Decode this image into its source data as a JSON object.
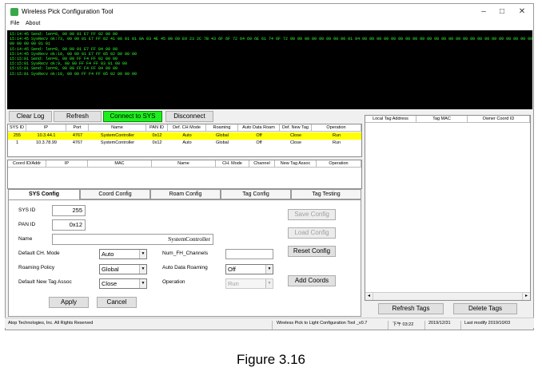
{
  "window": {
    "title": "Wireless Pick Configuration Tool",
    "minimize": "–",
    "maximize": "□",
    "close": "✕"
  },
  "menu": {
    "file": "File",
    "about": "About"
  },
  "console": {
    "lines": [
      "15:14:45 Send: len=8, 00 00 01 E7 FF 02 00 00",
      "15:14:45 SysRecv ok:73, 00 00 01 E7 FF 02 41 00 01 01 0A 03 4E 45 00 60 E9 23 2C 7B 43 6F 6F 72 64 69 6E 61 74 6F 72 00 00 00 00 00 00 00 00 01 04 00 00 00 00 00 00 00 00 00 00 00 00 00 00 00 00 00 00 00 00 00 00 00 00 00 00 00 00 00 00 00",
      "00 00 00 00 01 01",
      "15:14:45 Send: len=8, 00 00 01 E7 FF 04 00 00",
      "15:14:45 SysRecv ok:10, 00 00 01 E7 FF 05 02 00 00 00",
      "15:15:01 Send: len=8, 00 00 FF F4 FF 02 00 00",
      "15:15:01 SysRecv ok:9, 00 00 FF F4 FF 03 01 00 00",
      "15:15:01 Send: len=8, 00 00 FF F4 FF 04 00 00",
      "15:15:01 SysRecv ok:10, 00 00 FF F4 FF 05 02 00 00 00"
    ]
  },
  "toolbar": {
    "clear_log": "Clear Log",
    "refresh": "Refresh",
    "connect": "Connect to SYS",
    "disconnect": "Disconnect"
  },
  "sys_table": {
    "headers": [
      "SYS ID",
      "IP",
      "Port",
      "Name",
      "PAN ID",
      "Def. CH Mode",
      "Roaming",
      "Auto Data Roam",
      "Def. New Tag",
      "Operation"
    ],
    "rows": [
      [
        "255",
        "10.3.44.1",
        "4767",
        "SystemController",
        "0x12",
        "Auto",
        "Global",
        "Off",
        "Close",
        "Run"
      ],
      [
        "1",
        "10.3.78.99",
        "4767",
        "SystemController",
        "0x12",
        "Auto",
        "Global",
        "Off",
        "Close",
        "Run"
      ]
    ],
    "selected_color": "#ffff00"
  },
  "coord_table": {
    "headers": [
      "Coord ID/Addr",
      "IP",
      "MAC",
      "Name",
      "CH. Mode",
      "Channel",
      "New Tag Assoc",
      "Operation"
    ]
  },
  "tag_table": {
    "headers": [
      "Local Tag Address",
      "Tag MAC",
      "Owner Coord ID"
    ]
  },
  "tabs": [
    "SYS Config",
    "Coord Config",
    "Roam Config",
    "Tag Config",
    "Tag Testing"
  ],
  "form": {
    "sys_id_label": "SYS ID",
    "sys_id": "255",
    "pan_id_label": "PAN ID",
    "pan_id": "0x12",
    "name_label": "Name",
    "name": "SystemController",
    "def_ch_label": "Default CH. Mode",
    "def_ch": "Auto",
    "roaming_label": "Roaming Policy",
    "roaming": "Global",
    "new_tag_label": "Default New Tag Assoc",
    "new_tag": "Close",
    "num_fh_label": "Num_FH_Channels",
    "num_fh": "",
    "auto_roam_label": "Auto Data Roaming",
    "auto_roam": "Off",
    "operation_label": "Operation",
    "operation": "Run",
    "save_config": "Save Config",
    "load_config": "Load Config",
    "reset_config": "Reset Config",
    "add_coords": "Add Coords",
    "apply": "Apply",
    "cancel": "Cancel"
  },
  "tag_buttons": {
    "refresh_tags": "Refresh Tags",
    "delete_tags": "Delete Tags"
  },
  "status": {
    "company": "Atop Technologies, Inc. All Rights Reserved",
    "version": "Wireless Pick to Light Configuration Tool _v0.7",
    "time": "下午 03:22",
    "date": "2019/12/31",
    "modified": "Last modify  2019/10/03"
  },
  "caption": "Figure 3.16"
}
